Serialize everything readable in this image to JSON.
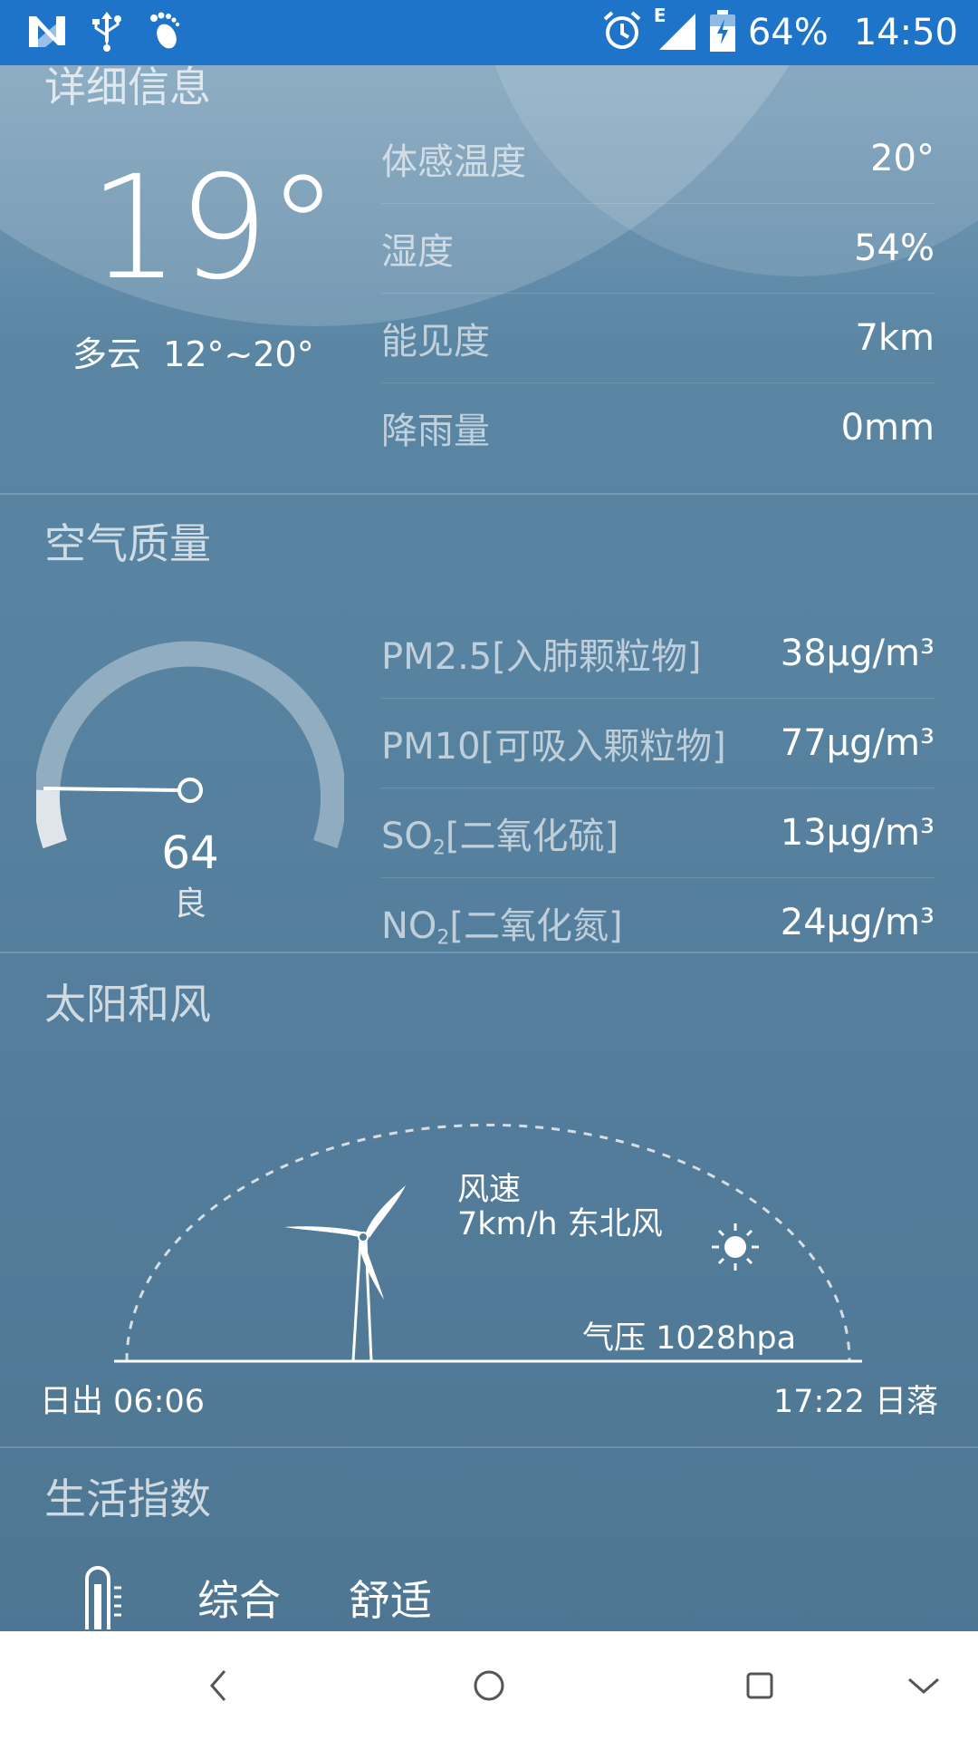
{
  "status_bar": {
    "icons_left": [
      "n-notification-icon",
      "usb-icon",
      "footprint-icon"
    ],
    "icons_right": [
      "alarm-icon",
      "signal-icon",
      "battery-icon"
    ],
    "network_type": "E",
    "battery": "64%",
    "time": "14:50"
  },
  "details": {
    "title": "详细信息",
    "temperature": "19°",
    "condition": "多云",
    "range": "12°~20°",
    "rows": [
      {
        "label": "体感温度",
        "value": "20°"
      },
      {
        "label": "湿度",
        "value": "54%"
      },
      {
        "label": "能见度",
        "value": "7km"
      },
      {
        "label": "降雨量",
        "value": "0mm"
      }
    ]
  },
  "air": {
    "title": "空气质量",
    "aqi": "64",
    "level": "良",
    "rows": [
      {
        "label": "PM2.5[入肺颗粒物]",
        "value": "38μg/m³"
      },
      {
        "label": "PM10[可吸入颗粒物]",
        "value": "77μg/m³"
      },
      {
        "label_prefix": "SO",
        "label_sub": "2",
        "label_suffix": "[二氧化硫]",
        "value": "13μg/m³"
      },
      {
        "label_prefix": "NO",
        "label_sub": "2",
        "label_suffix": "[二氧化氮]",
        "value": "24μg/m³"
      }
    ]
  },
  "sun_wind": {
    "title": "太阳和风",
    "wind_label": "风速",
    "wind_value": "7km/h 东北风",
    "pressure": "气压 1028hpa",
    "sunrise": "日出 06:06",
    "sunset": "17:22 日落",
    "sun_progress": 0.82
  },
  "life": {
    "title": "生活指数",
    "items": [
      {
        "name": "综合",
        "value": "舒适",
        "icon": "thermometer-icon"
      }
    ]
  },
  "nav": {
    "buttons": [
      "back-icon",
      "home-icon",
      "recents-icon",
      "hide-nav-icon"
    ]
  },
  "colors": {
    "status_bar": "#1e74c8",
    "background": "#4f7b99",
    "nav_bar": "#ffffff"
  }
}
